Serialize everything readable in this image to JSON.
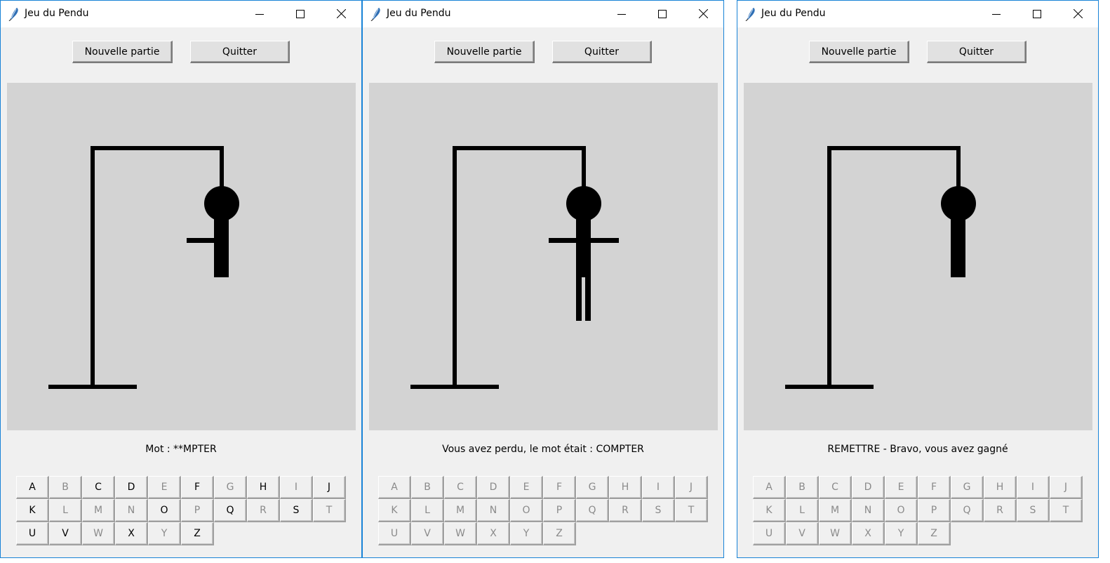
{
  "windows": [
    {
      "title": "Jeu du Pendu",
      "new_game_label": "Nouvelle partie",
      "quit_label": "Quitter",
      "status": "Mot : **MPTER",
      "hangman_stage": [
        "gallows",
        "rope",
        "head",
        "body",
        "left-arm"
      ],
      "enabled_letters": [
        "A",
        "C",
        "D",
        "F",
        "H",
        "J",
        "K",
        "O",
        "Q",
        "S",
        "U",
        "V",
        "X",
        "Z"
      ]
    },
    {
      "title": "Jeu du Pendu",
      "new_game_label": "Nouvelle partie",
      "quit_label": "Quitter",
      "status": "Vous avez perdu, le mot était : COMPTER",
      "hangman_stage": [
        "gallows",
        "rope",
        "head",
        "body",
        "left-arm",
        "right-arm",
        "left-leg",
        "right-leg"
      ],
      "enabled_letters": []
    },
    {
      "title": "Jeu du Pendu",
      "new_game_label": "Nouvelle partie",
      "quit_label": "Quitter",
      "status": "REMETTRE - Bravo, vous avez gagné",
      "hangman_stage": [
        "gallows",
        "rope",
        "head",
        "body"
      ],
      "enabled_letters": []
    }
  ],
  "letters": [
    "A",
    "B",
    "C",
    "D",
    "E",
    "F",
    "G",
    "H",
    "I",
    "J",
    "K",
    "L",
    "M",
    "N",
    "O",
    "P",
    "Q",
    "R",
    "S",
    "T",
    "U",
    "V",
    "W",
    "X",
    "Y",
    "Z"
  ],
  "colors": {
    "canvas": "#d3d3d3",
    "window_bg": "#f0f0f0",
    "drawing": "#000000",
    "disabled_text": "#8a8a8a",
    "border_accent": "#1883d7"
  },
  "icons": {
    "app": "feather-icon",
    "minimize": "minimize-icon",
    "maximize": "maximize-icon",
    "close": "close-icon"
  }
}
